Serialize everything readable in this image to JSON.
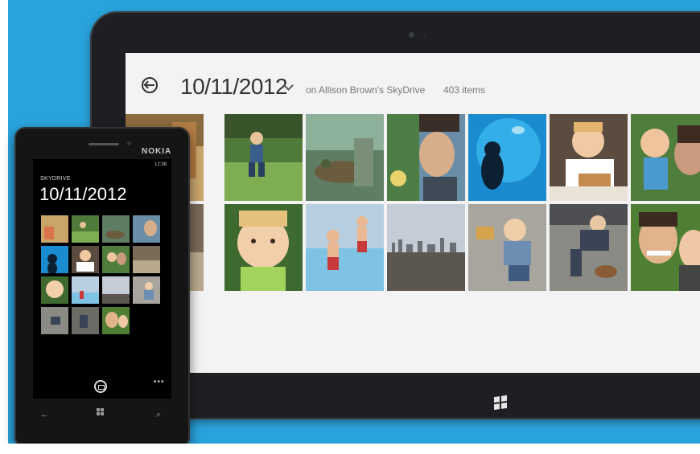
{
  "tablet": {
    "app": {
      "back_icon": "back-arrow-icon",
      "title": "10/11/2012",
      "dropdown_icon": "chevron-down-icon",
      "location_text": "on Allison Brown's SkyDrive",
      "item_count": "403 items"
    },
    "start_icon": "windows-logo-icon"
  },
  "phone": {
    "brand": "NOKIA",
    "status_time": "12:38",
    "app_label": "SKYDRIVE",
    "title": "10/11/2012",
    "more_icon_text": "•••",
    "nav": {
      "back_text": "←",
      "start_icon": "windows-logo-icon",
      "search_text": "⌕"
    }
  },
  "colors": {
    "background": "#2aa3dc",
    "tablet_bezel": "#1d1f22",
    "screen": "#f3f3f3",
    "phone_body": "#151515"
  }
}
